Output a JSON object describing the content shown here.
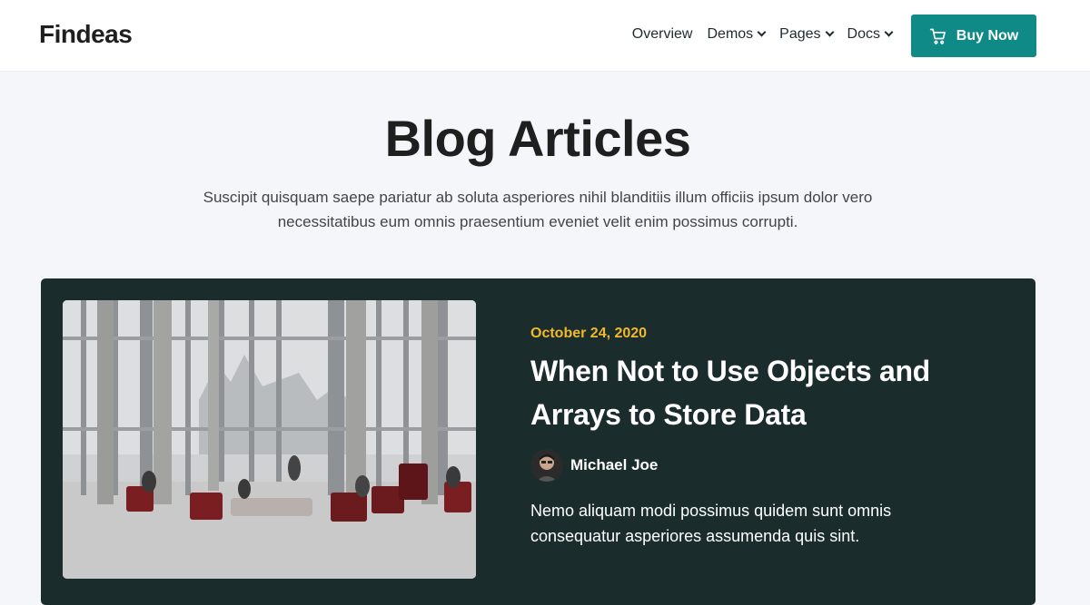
{
  "header": {
    "logo": "Findeas",
    "nav": [
      {
        "label": "Overview",
        "dropdown": false
      },
      {
        "label": "Demos",
        "dropdown": true
      },
      {
        "label": "Pages",
        "dropdown": true
      },
      {
        "label": "Docs",
        "dropdown": true
      }
    ],
    "buy_button": {
      "label": "Buy Now",
      "icon": "cart-icon",
      "color": "#0f8a87"
    }
  },
  "hero": {
    "title": "Blog Articles",
    "subtitle": "Suscipit quisquam saepe pariatur ab soluta asperiores nihil blanditiis illum officiis ipsum dolor vero necessitatibus eum omnis praesentium eveniet velit enim possimus corrupti."
  },
  "featured_post": {
    "background": "#1a2d2c",
    "date": "October 24, 2020",
    "date_color": "#f2b82b",
    "title": "When Not to Use Objects and Arrays to Store Data",
    "author": "Michael Joe",
    "excerpt": "Nemo aliquam modi possimus quidem sunt omnis consequatur asperiores assumenda quis sint."
  }
}
